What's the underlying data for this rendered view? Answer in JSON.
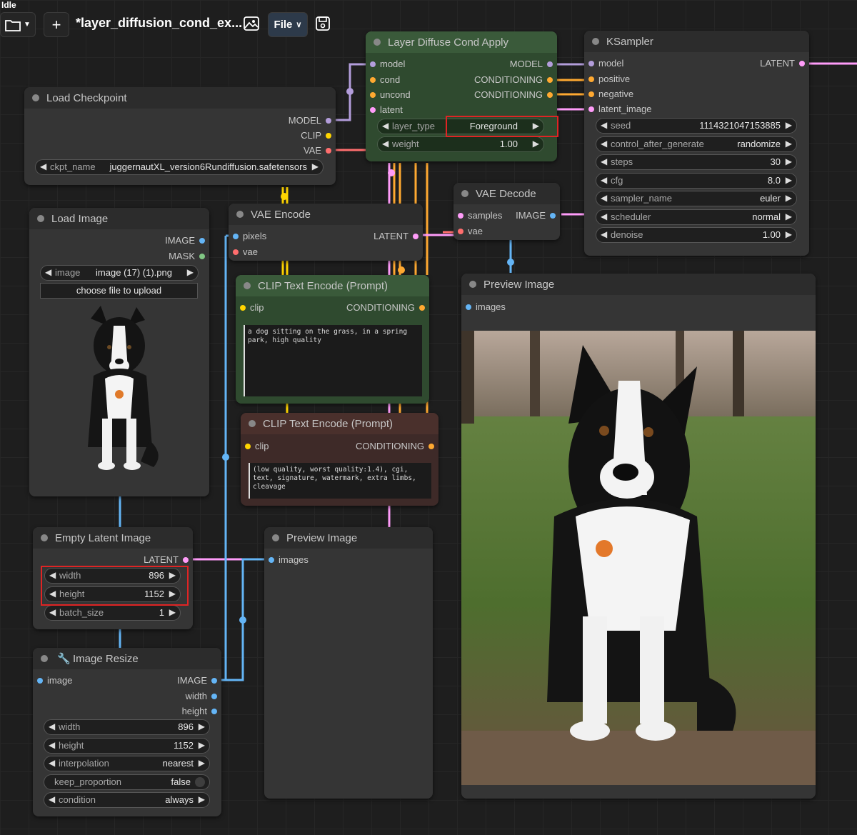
{
  "app": {
    "status": "Idle",
    "workflow_title": "*layer_diffusion_cond_ex...",
    "file_menu": "File"
  },
  "colors": {
    "model": "#b39ddb",
    "clip": "#ffd500",
    "vae": "#ff6e6e",
    "latent": "#ff9cf9",
    "conditioning": "#ffa931",
    "image": "#64b5f6",
    "mask": "#81c784",
    "highlight": "#e02424"
  },
  "nodes": {
    "load_checkpoint": {
      "title": "Load Checkpoint",
      "outputs": [
        "MODEL",
        "CLIP",
        "VAE"
      ],
      "ckpt": {
        "label": "ckpt_name",
        "value": "juggernautXL_version6Rundiffusion.safetensors"
      }
    },
    "layer_diffuse": {
      "title": "Layer Diffuse Cond Apply",
      "inputs": [
        "model",
        "cond",
        "uncond",
        "latent"
      ],
      "outputs": [
        "MODEL",
        "CONDITIONING",
        "CONDITIONING"
      ],
      "layer_type": {
        "label": "layer_type",
        "value": "Foreground"
      },
      "weight": {
        "label": "weight",
        "value": "1.00"
      }
    },
    "ksampler": {
      "title": "KSampler",
      "inputs": [
        "model",
        "positive",
        "negative",
        "latent_image"
      ],
      "output": "LATENT",
      "widgets": [
        {
          "label": "seed",
          "value": "1114321047153885"
        },
        {
          "label": "control_after_generate",
          "value": "randomize"
        },
        {
          "label": "steps",
          "value": "30"
        },
        {
          "label": "cfg",
          "value": "8.0"
        },
        {
          "label": "sampler_name",
          "value": "euler"
        },
        {
          "label": "scheduler",
          "value": "normal"
        },
        {
          "label": "denoise",
          "value": "1.00"
        }
      ]
    },
    "vae_decode": {
      "title": "VAE Decode",
      "inputs": [
        "samples",
        "vae"
      ],
      "output": "IMAGE"
    },
    "load_image": {
      "title": "Load Image",
      "outputs": [
        "IMAGE",
        "MASK"
      ],
      "image": {
        "label": "image",
        "value": "image (17) (1).png"
      },
      "upload": "choose file to upload"
    },
    "vae_encode": {
      "title": "VAE Encode",
      "inputs": [
        "pixels",
        "vae"
      ],
      "output": "LATENT"
    },
    "clip_pos": {
      "title": "CLIP Text Encode (Prompt)",
      "input": "clip",
      "output": "CONDITIONING",
      "text": "a dog sitting on the grass, in a spring park, high quality"
    },
    "clip_neg": {
      "title": "CLIP Text Encode (Prompt)",
      "input": "clip",
      "output": "CONDITIONING",
      "text": "(low quality, worst quality:1.4), cgi, text, signature, watermark, extra limbs, cleavage"
    },
    "preview_right": {
      "title": "Preview Image",
      "input": "images"
    },
    "preview_mid": {
      "title": "Preview Image",
      "input": "images"
    },
    "empty_latent": {
      "title": "Empty Latent Image",
      "output": "LATENT",
      "widgets": [
        {
          "label": "width",
          "value": "896"
        },
        {
          "label": "height",
          "value": "1152"
        },
        {
          "label": "batch_size",
          "value": "1"
        }
      ]
    },
    "image_resize": {
      "title": "Image Resize",
      "input": "image",
      "outputs": [
        "IMAGE",
        "width",
        "height"
      ],
      "widgets": [
        {
          "label": "width",
          "value": "896"
        },
        {
          "label": "height",
          "value": "1152"
        },
        {
          "label": "interpolation",
          "value": "nearest"
        },
        {
          "label": "keep_proportion",
          "value": "false"
        },
        {
          "label": "condition",
          "value": "always"
        }
      ]
    }
  }
}
